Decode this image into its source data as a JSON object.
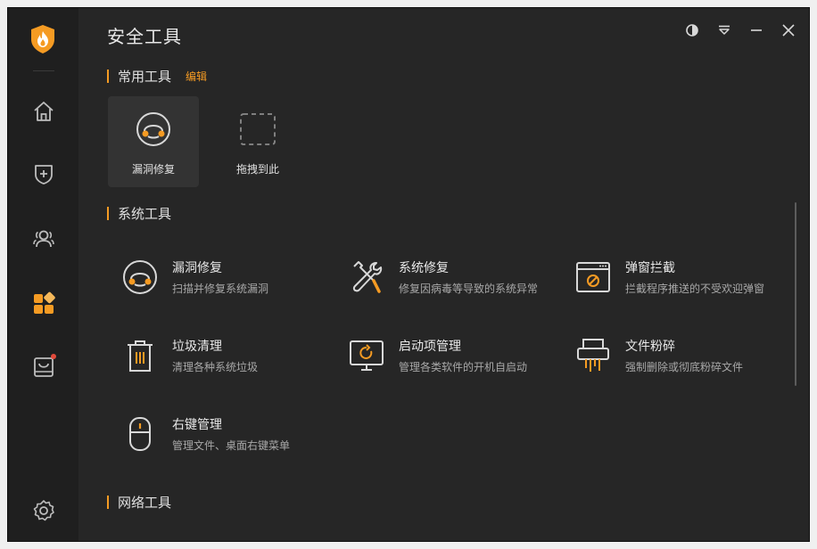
{
  "app": {
    "title": "安全工具"
  },
  "colors": {
    "accent": "#f59b23",
    "bg": "#262626",
    "sidebar": "#1f1f1f"
  },
  "sidebar": {
    "logo": "shield-fire-logo",
    "items": [
      {
        "id": "home",
        "icon": "home-icon"
      },
      {
        "id": "protect",
        "icon": "shield-plus-icon"
      },
      {
        "id": "users",
        "icon": "users-icon"
      },
      {
        "id": "tools",
        "icon": "apps-icon",
        "active": true
      },
      {
        "id": "store",
        "icon": "bag-icon",
        "badge": true
      },
      {
        "id": "settings",
        "icon": "gear-icon"
      }
    ]
  },
  "window_controls": [
    "theme-icon",
    "menu-icon",
    "minimize-icon",
    "close-icon"
  ],
  "sections": {
    "common": {
      "title": "常用工具",
      "edit": "编辑"
    },
    "system": {
      "title": "系统工具"
    },
    "network": {
      "title": "网络工具"
    }
  },
  "quick_tools": [
    {
      "label": "漏洞修复",
      "icon": "vulnerability-fix-icon"
    },
    {
      "label": "拖拽到此",
      "icon": "drop-target-icon"
    }
  ],
  "system_tools": [
    {
      "name": "漏洞修复",
      "desc": "扫描并修复系统漏洞",
      "icon": "vulnerability-fix-icon"
    },
    {
      "name": "系统修复",
      "desc": "修复因病毒等导致的系统异常",
      "icon": "tools-icon"
    },
    {
      "name": "弹窗拦截",
      "desc": "拦截程序推送的不受欢迎弹窗",
      "icon": "popup-block-icon"
    },
    {
      "name": "垃圾清理",
      "desc": "清理各种系统垃圾",
      "icon": "trash-icon"
    },
    {
      "name": "启动项管理",
      "desc": "管理各类软件的开机自启动",
      "icon": "startup-monitor-icon"
    },
    {
      "name": "文件粉碎",
      "desc": "强制删除或彻底粉碎文件",
      "icon": "shredder-icon"
    },
    {
      "name": "右键管理",
      "desc": "管理文件、桌面右键菜单",
      "icon": "mouse-icon"
    }
  ]
}
